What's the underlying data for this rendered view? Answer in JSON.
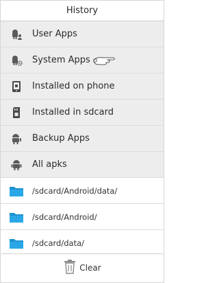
{
  "dialog": {
    "title": "History"
  },
  "categories": [
    {
      "label": "User Apps",
      "icon": "android-person-icon"
    },
    {
      "label": "System Apps",
      "icon": "android-gear-icon"
    },
    {
      "label": "Installed on phone",
      "icon": "phone-icon"
    },
    {
      "label": "Installed in sdcard",
      "icon": "sdcard-icon"
    },
    {
      "label": "Backup Apps",
      "icon": "android-backup-icon"
    },
    {
      "label": "All apks",
      "icon": "android-icon"
    }
  ],
  "folders": [
    {
      "label": "/sdcard/Android/data/",
      "icon": "folder-icon"
    },
    {
      "label": "/sdcard/Android/",
      "icon": "folder-icon"
    },
    {
      "label": "/sdcard/data/",
      "icon": "folder-icon"
    }
  ],
  "footer": {
    "clear_label": "Clear",
    "icon": "trash-icon"
  },
  "colors": {
    "folder": "#2aa7e6",
    "icon_gray": "#5a5a5a",
    "row_bg": "#ededed"
  }
}
